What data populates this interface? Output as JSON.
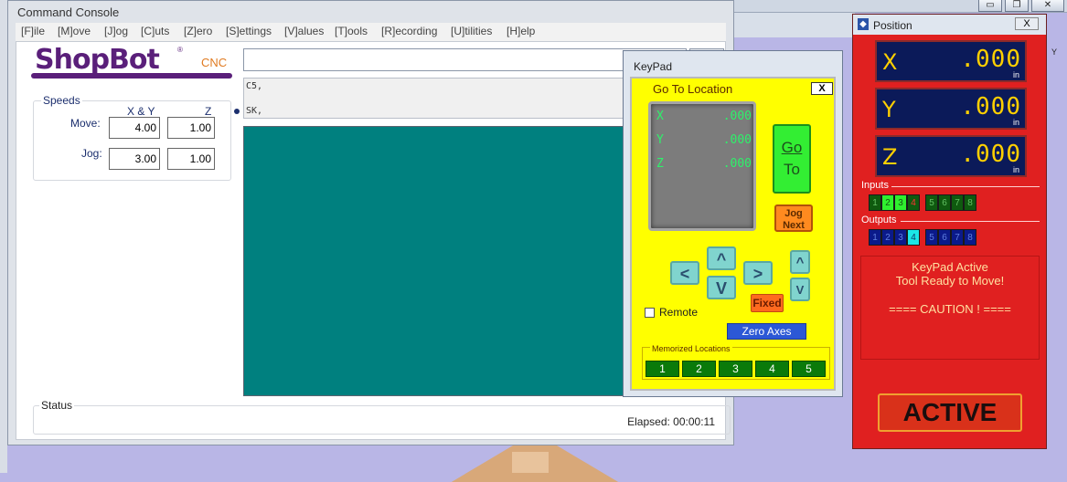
{
  "console": {
    "title": "Command Console",
    "menu": [
      "[F]ile",
      "[M]ove",
      "[J]og",
      "[C]uts",
      "[Z]ero",
      "[S]ettings",
      "[V]alues",
      "[T]ools",
      "[R]ecording",
      "[U]tilities",
      "[H]elp"
    ],
    "logo": {
      "name": "ShopBot",
      "suffix": "CNC",
      "mark": "®"
    },
    "speeds": {
      "title": "Speeds",
      "col_xy": "X & Y",
      "col_z": "Z",
      "move_label": "Move:",
      "move_xy": "4.00",
      "move_z": "1.00",
      "jog_label": "Jog:",
      "jog_xy": "3.00",
      "jog_z": "1.00"
    },
    "history": [
      "C5,",
      "SK,"
    ],
    "status": {
      "title": "Status",
      "elapsed": "Elapsed: 00:00:11"
    }
  },
  "keypad": {
    "title": "KeyPad",
    "goto_title": "Go To Location",
    "close": "X",
    "lcd": [
      {
        "axis": "X",
        "value": ".000"
      },
      {
        "axis": "Y",
        "value": ".000"
      },
      {
        "axis": "Z",
        "value": ".000"
      }
    ],
    "go_line1": "Go",
    "go_line2": "To",
    "jog_line1": "Jog",
    "jog_line2": "Next",
    "up": "^",
    "down": "V",
    "left": "<",
    "right": ">",
    "z_up": "^",
    "z_down": "V",
    "fixed": "Fixed",
    "remote": "Remote",
    "zero_axes": "Zero Axes",
    "memorized_title": "Memorized Locations",
    "memorized": [
      "1",
      "2",
      "3",
      "4",
      "5"
    ]
  },
  "position": {
    "title": "Position",
    "close": "X",
    "axes": [
      {
        "axis": "X",
        "value": ".000",
        "unit": "in"
      },
      {
        "axis": "Y",
        "value": ".000",
        "unit": "in"
      },
      {
        "axis": "Z",
        "value": ".000",
        "unit": "in"
      }
    ],
    "inputs_label": "Inputs",
    "inputs": [
      "1",
      "2",
      "3",
      "4",
      "5",
      "6",
      "7",
      "8"
    ],
    "outputs_label": "Outputs",
    "outputs": [
      "1",
      "2",
      "3",
      "4",
      "5",
      "6",
      "7",
      "8"
    ],
    "msg_line1": "KeyPad Active",
    "msg_line2": "Tool Ready to Move!",
    "msg_line3": "==== CAUTION ! ====",
    "active": "ACTIVE"
  },
  "desktop": {
    "y_axis": "Y"
  },
  "colors": {
    "keypad_bg": "#ffff00",
    "position_bg": "#e02020",
    "preview_bg": "#00807f",
    "logo": "#5a1f7a",
    "lcd_text": "#2df26a"
  }
}
